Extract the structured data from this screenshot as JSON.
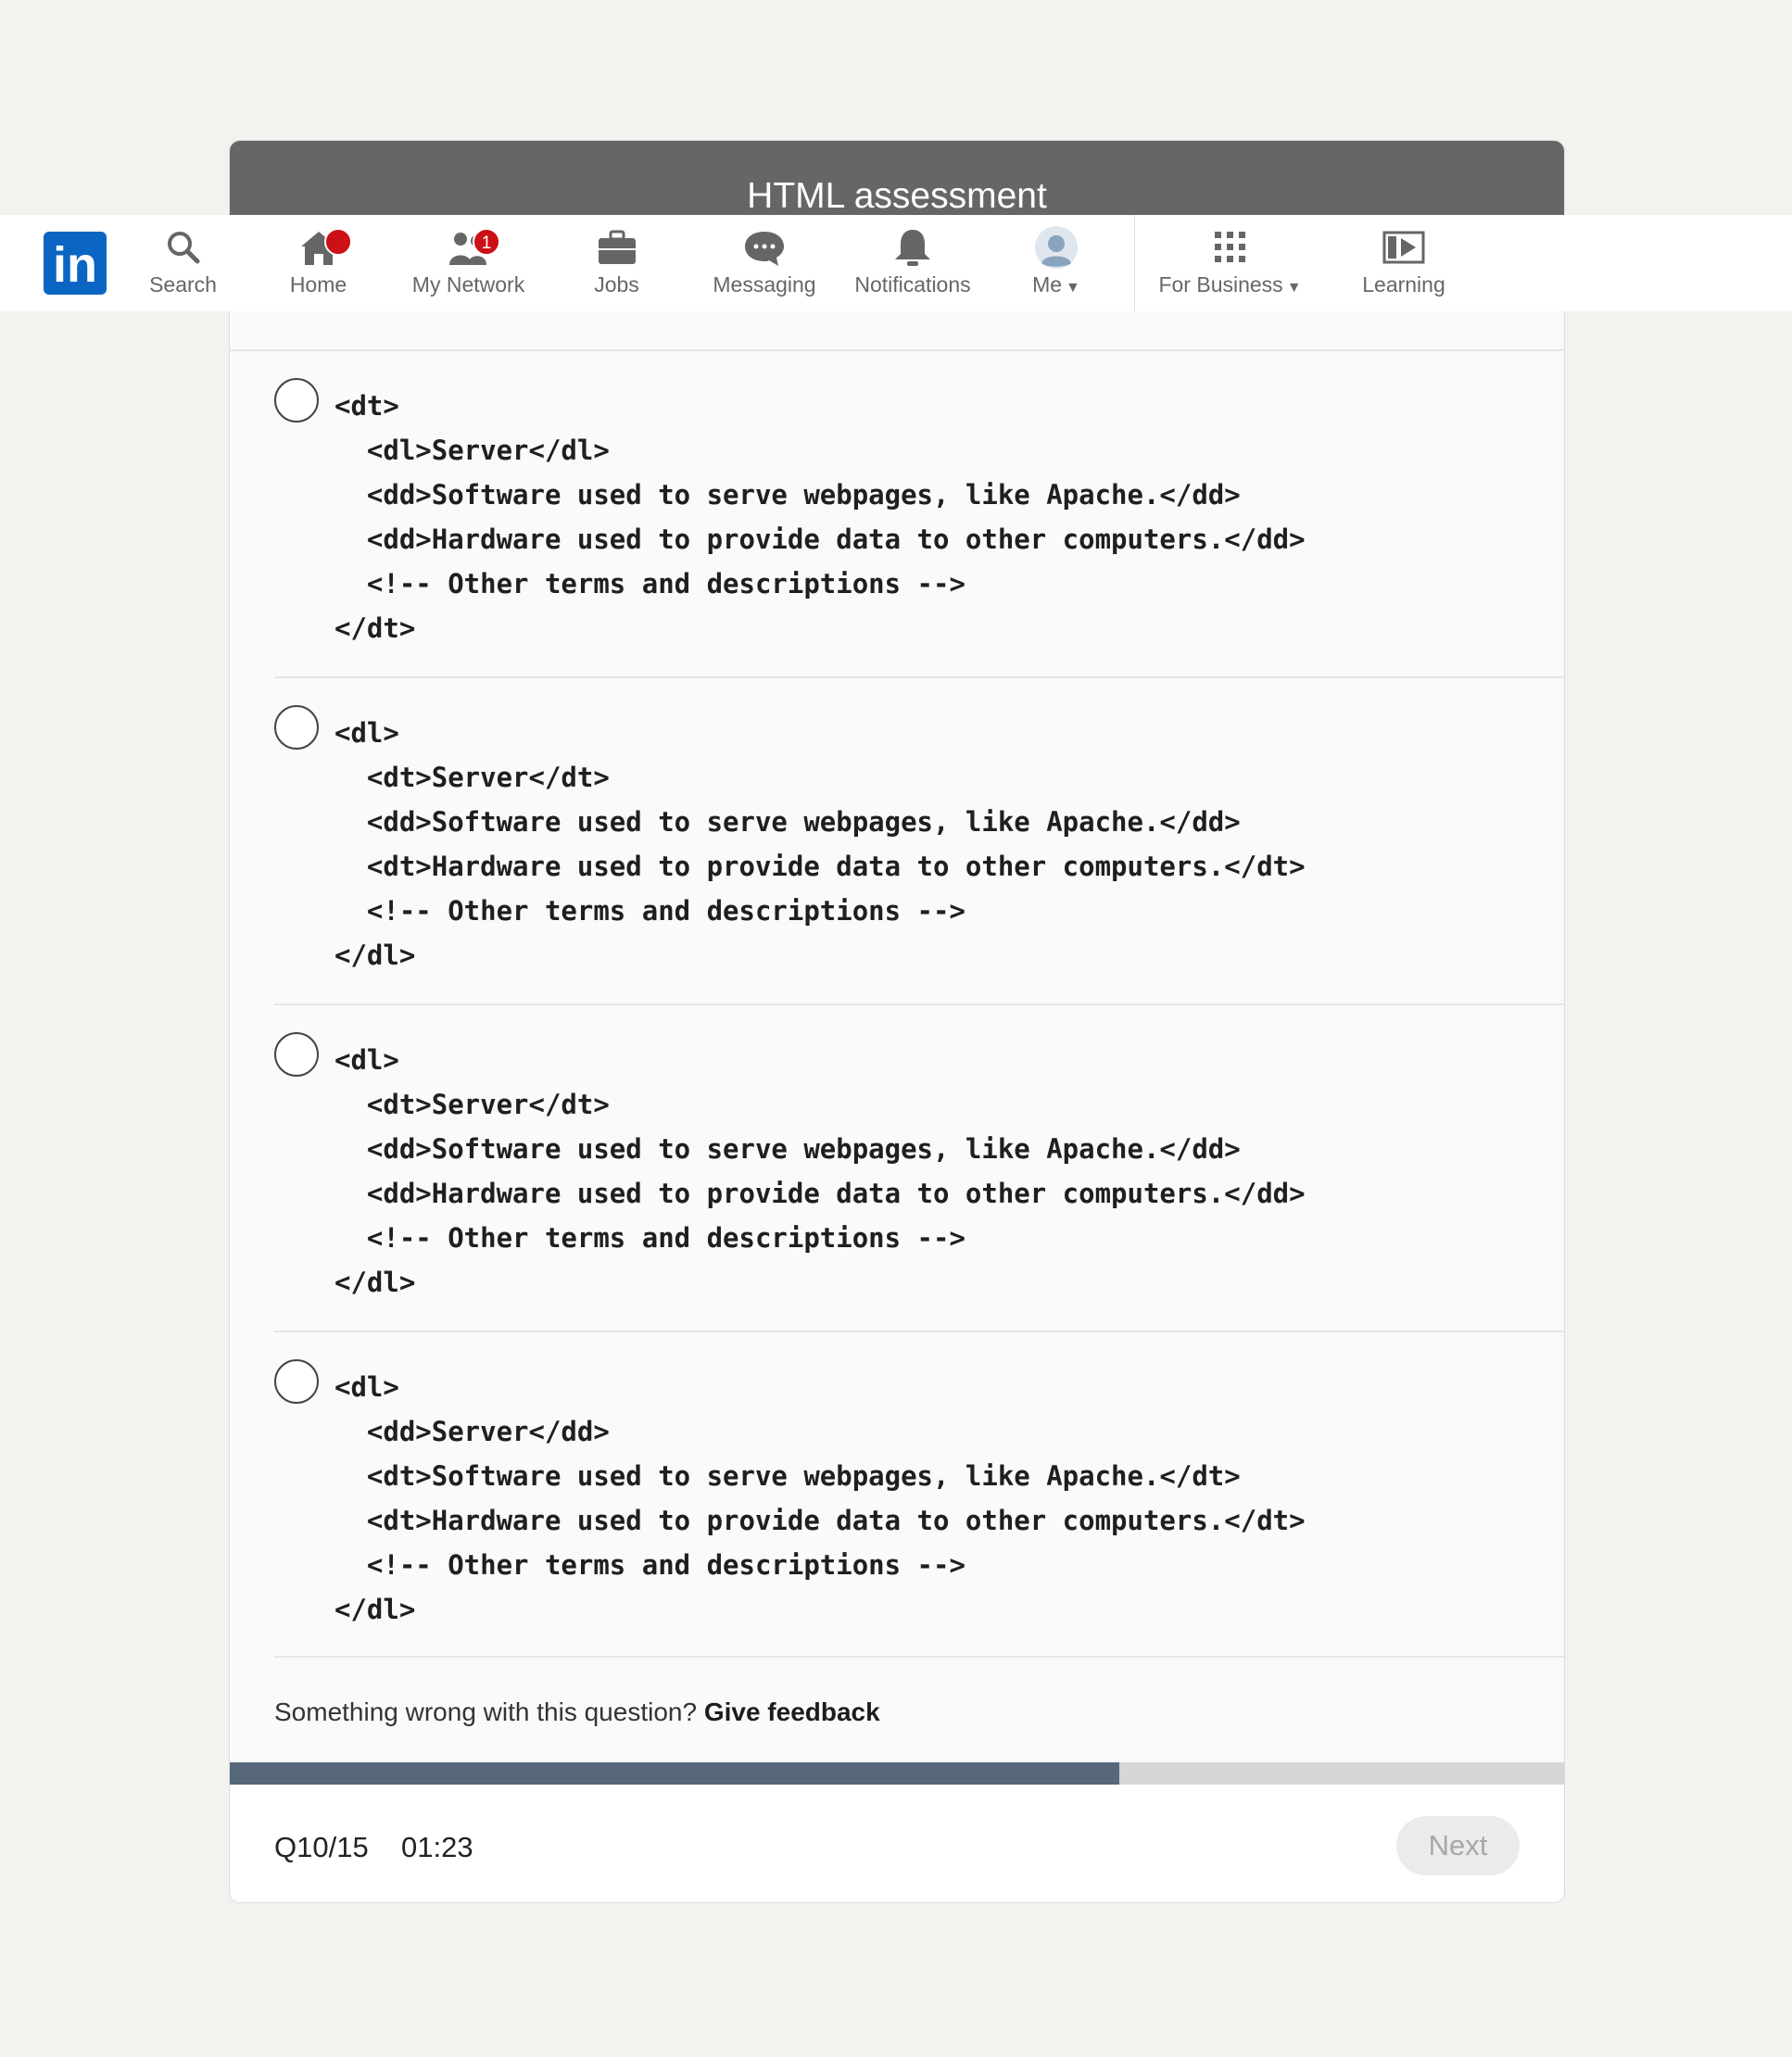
{
  "modal": {
    "title": "HTML assessment",
    "options": [
      {
        "code": "<dt>\n  <dl>Server</dl>\n  <dd>Software used to serve webpages, like Apache.</dd>\n  <dd>Hardware used to provide data to other computers.</dd>\n  <!-- Other terms and descriptions -->\n</dt>"
      },
      {
        "code": "<dl>\n  <dt>Server</dt>\n  <dd>Software used to serve webpages, like Apache.</dd>\n  <dt>Hardware used to provide data to other computers.</dt>\n  <!-- Other terms and descriptions -->\n</dl>"
      },
      {
        "code": "<dl>\n  <dt>Server</dt>\n  <dd>Software used to serve webpages, like Apache.</dd>\n  <dd>Hardware used to provide data to other computers.</dd>\n  <!-- Other terms and descriptions -->\n</dl>"
      },
      {
        "code": "<dl>\n  <dd>Server</dd>\n  <dt>Software used to serve webpages, like Apache.</dt>\n  <dt>Hardware used to provide data to other computers.</dt>\n  <!-- Other terms and descriptions -->\n</dl>"
      }
    ],
    "feedback_text": "Something wrong with this question?",
    "feedback_link": "Give feedback",
    "progress": 0.667,
    "question_counter": "Q10/15",
    "timer": "01:23",
    "next_label": "Next"
  },
  "navbar": {
    "logo_text": "in",
    "items": [
      {
        "label": "Search",
        "icon": "search-icon"
      },
      {
        "label": "Home",
        "icon": "home-icon"
      },
      {
        "label": "My Network",
        "icon": "network-icon",
        "badge": "1"
      },
      {
        "label": "Jobs",
        "icon": "briefcase-icon"
      },
      {
        "label": "Messaging",
        "icon": "messaging-icon"
      },
      {
        "label": "Notifications",
        "icon": "bell-icon"
      },
      {
        "label": "Me",
        "icon": "avatar"
      },
      {
        "label": "For Business",
        "icon": "grid-icon"
      },
      {
        "label": "Learning",
        "icon": "learning-icon"
      }
    ]
  },
  "colors": {
    "linkedin_blue": "#0a66c2",
    "badge_red": "#cc1016",
    "progress_fill": "#56687a"
  }
}
